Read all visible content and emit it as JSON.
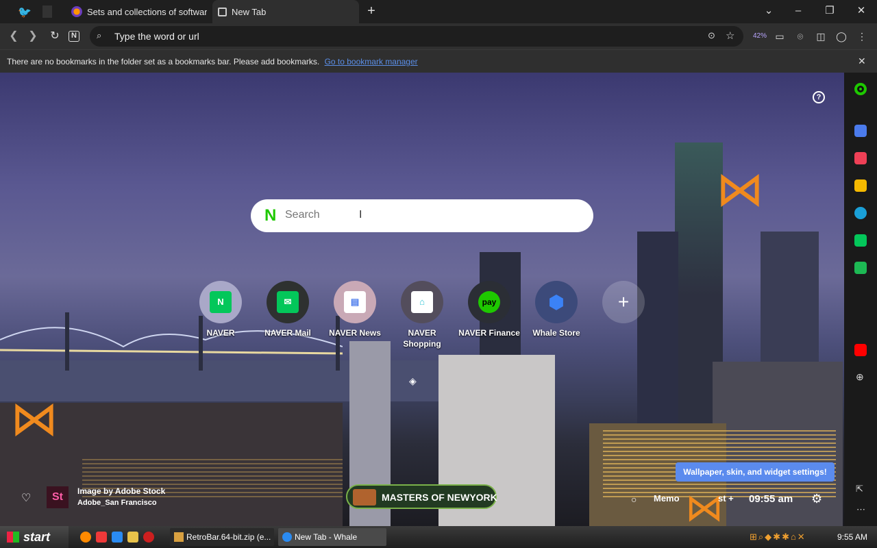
{
  "tabs": [
    {
      "label": "Sets and collections of softwar"
    },
    {
      "label": "New Tab"
    }
  ],
  "addressbar": {
    "placeholder": "Type the word or url",
    "zoom": "42%"
  },
  "bookmarks": {
    "message": "There are no bookmarks in the folder set as a bookmarks bar. Please add bookmarks.",
    "link": "Go to bookmark manager"
  },
  "search": {
    "placeholder": "Search",
    "logo": "N"
  },
  "shortcuts": [
    {
      "label": "NAVER",
      "icon": "N",
      "bg": "#a9a8c8",
      "fg": "#03c75a",
      "fgtext": "#fff"
    },
    {
      "label": "NAVER Mail",
      "icon": "✉",
      "bg": "#2e3130",
      "fg": "#03c75a",
      "fgtext": "#fff"
    },
    {
      "label": "NAVER News",
      "icon": "▤",
      "bg": "#c9a9b6",
      "fg": "#4b7bec",
      "fgtext": "#fff"
    },
    {
      "label": "NAVER Shopping",
      "icon": "⌂",
      "bg": "#534d5c",
      "fg": "#2ec4d6",
      "fgtext": "#fff"
    },
    {
      "label": "NAVER Finance",
      "icon": "pay",
      "bg": "#2b2e35",
      "fg": "#1ec800",
      "fgtext": "#000"
    },
    {
      "label": "Whale Store",
      "icon": "⬢",
      "bg": "#3c4a7a",
      "fg": "#3b82f6",
      "fgtext": "#fff"
    }
  ],
  "add_shortcut": "+",
  "help": "?",
  "tooltip": "Wallpaper, skin, and widget settings!",
  "credit": {
    "badge": "St",
    "line1": "Image by Adobe Stock",
    "line2": "Adobe_San Francisco"
  },
  "banner": "MASTERS OF NEWYORK",
  "widgets": {
    "memo": "Memo",
    "plus": "st +",
    "time": "09:55 am"
  },
  "taskbar": {
    "start": "start",
    "tasks": [
      "RetroBar.64-bit.zip (e...",
      "New Tab - Whale"
    ],
    "clock": "9:55 AM"
  }
}
